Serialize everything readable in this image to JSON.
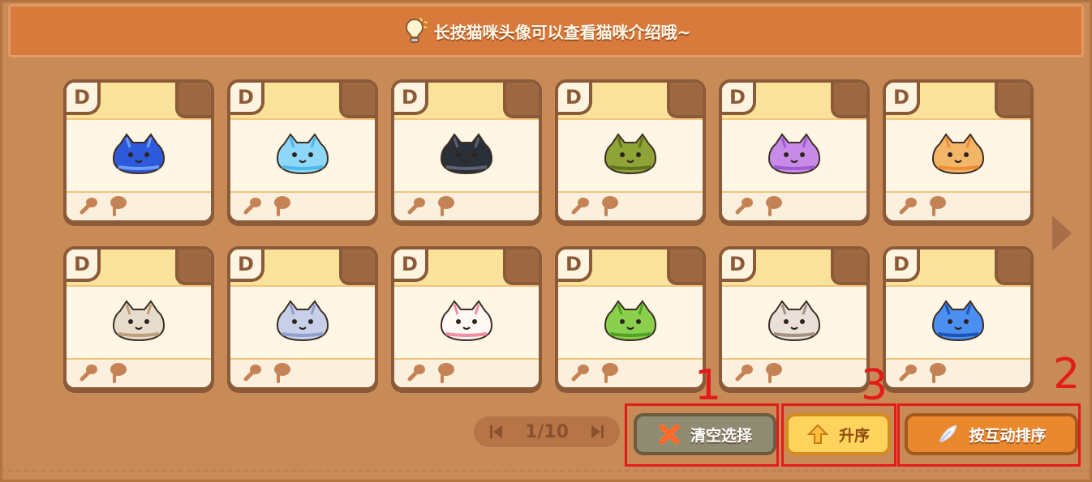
{
  "tip": "长按猫咪头像可以查看猫咪介绍哦~",
  "cards": [
    {
      "rank": "D",
      "cat_color": "#2e59d8",
      "cat_accent": "#6f9cff"
    },
    {
      "rank": "D",
      "cat_color": "#8dd8f8",
      "cat_accent": "#4db6ea"
    },
    {
      "rank": "D",
      "cat_color": "#2b3038",
      "cat_accent": "#596272"
    },
    {
      "rank": "D",
      "cat_color": "#8fa337",
      "cat_accent": "#5f721d"
    },
    {
      "rank": "D",
      "cat_color": "#c98be8",
      "cat_accent": "#9c5bd0"
    },
    {
      "rank": "D",
      "cat_color": "#f3b568",
      "cat_accent": "#ee8d34"
    },
    {
      "rank": "D",
      "cat_color": "#e6dccb",
      "cat_accent": "#bf9e7c"
    },
    {
      "rank": "D",
      "cat_color": "#c8cfe8",
      "cat_accent": "#8f9fd0"
    },
    {
      "rank": "D",
      "cat_color": "#fff8f4",
      "cat_accent": "#f28ca2"
    },
    {
      "rank": "D",
      "cat_color": "#8ad04d",
      "cat_accent": "#4ea324"
    },
    {
      "rank": "D",
      "cat_color": "#e9e1d7",
      "cat_accent": "#a5917f"
    },
    {
      "rank": "D",
      "cat_color": "#4b8ff0",
      "cat_accent": "#1c55b6"
    }
  ],
  "pager": {
    "text": "1/10"
  },
  "buttons": {
    "clear": "清空选择",
    "sort": "升序",
    "interact": "按互动排序"
  },
  "annotations": {
    "n1": "1",
    "n2": "2",
    "n3": "3"
  }
}
